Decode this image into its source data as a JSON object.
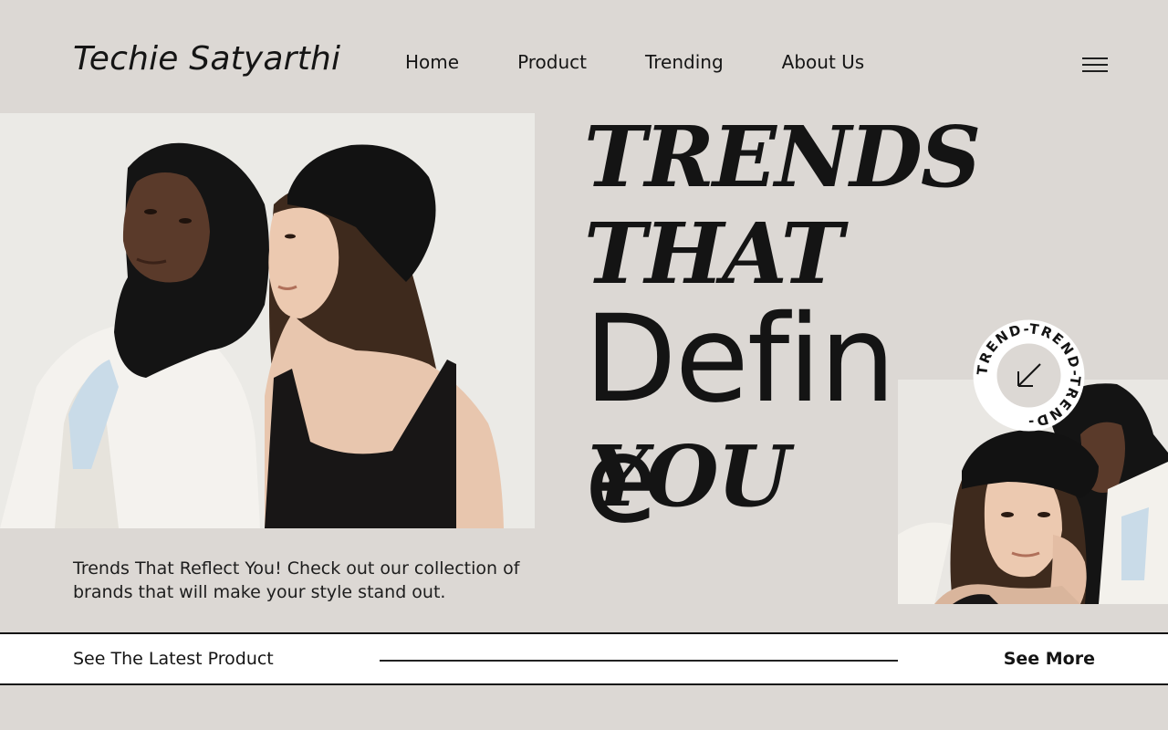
{
  "header": {
    "logo": "Techie Satyarthi",
    "nav": [
      {
        "label": "Home"
      },
      {
        "label": "Product"
      },
      {
        "label": "Trending"
      },
      {
        "label": "About Us"
      }
    ],
    "menu_icon": "hamburger-menu-icon"
  },
  "hero": {
    "headline_line1": "TRENDS",
    "headline_line2": "THAT",
    "headline_line3": "Define",
    "headline_line4": "YOU",
    "description": "Trends That Reflect You! Check out our collection of brands that will make your style stand out.",
    "badge_text": "TREND-TREND-TREND-",
    "badge_icon": "arrow-down-left-icon"
  },
  "strip": {
    "latest_label": "See The Latest Product",
    "see_more_label": "See More"
  },
  "colors": {
    "background": "#dcd8d4",
    "text": "#141414",
    "strip_background": "#ffffff"
  }
}
